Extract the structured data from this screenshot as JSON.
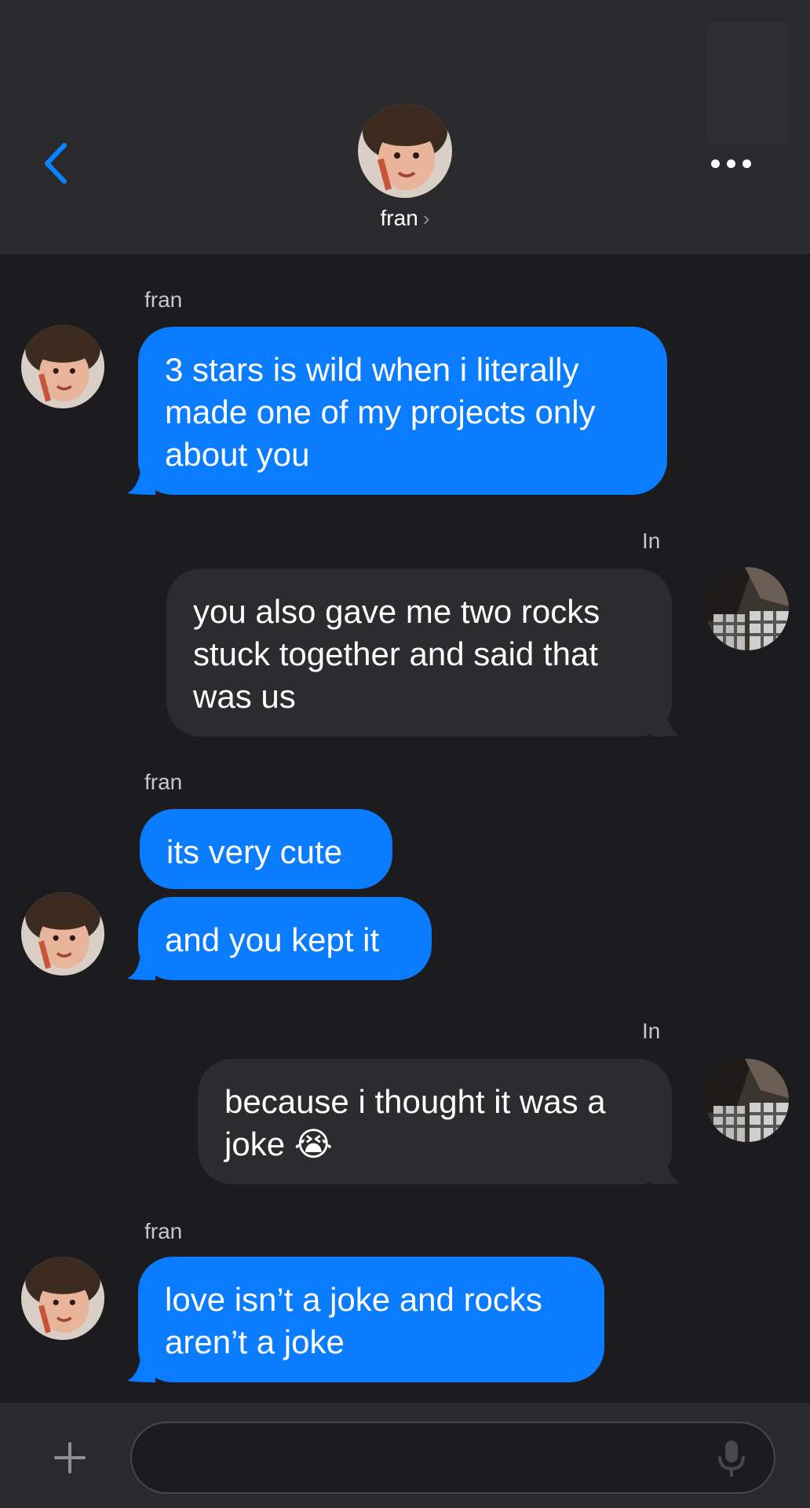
{
  "header": {
    "contact_name": "fran",
    "chevron": "›",
    "back_icon": "chevron-left-icon",
    "more_icon": "ellipsis-icon"
  },
  "messages": [
    {
      "direction": "incoming",
      "sender": "fran",
      "text": "3 stars is wild when i literally made one of my projects only about you"
    },
    {
      "direction": "outgoing",
      "sender": "In",
      "text": "you also gave me two rocks stuck together and said that was us"
    },
    {
      "direction": "incoming",
      "sender": "fran",
      "text": "its very cute"
    },
    {
      "direction": "incoming",
      "sender": "",
      "text": "and you kept it"
    },
    {
      "direction": "outgoing",
      "sender": "In",
      "text": "because i thought it was a joke 😭"
    },
    {
      "direction": "incoming",
      "sender": "fran",
      "text": "love isn’t a joke and rocks aren’t a joke"
    }
  ],
  "composer": {
    "placeholder": "",
    "plus_icon": "plus-icon",
    "mic_icon": "microphone-icon"
  },
  "colors": {
    "incoming_bubble": "#0a7cff",
    "outgoing_bubble": "#2c2c2e",
    "accent": "#0a84ff",
    "background": "#1c1c1e"
  }
}
